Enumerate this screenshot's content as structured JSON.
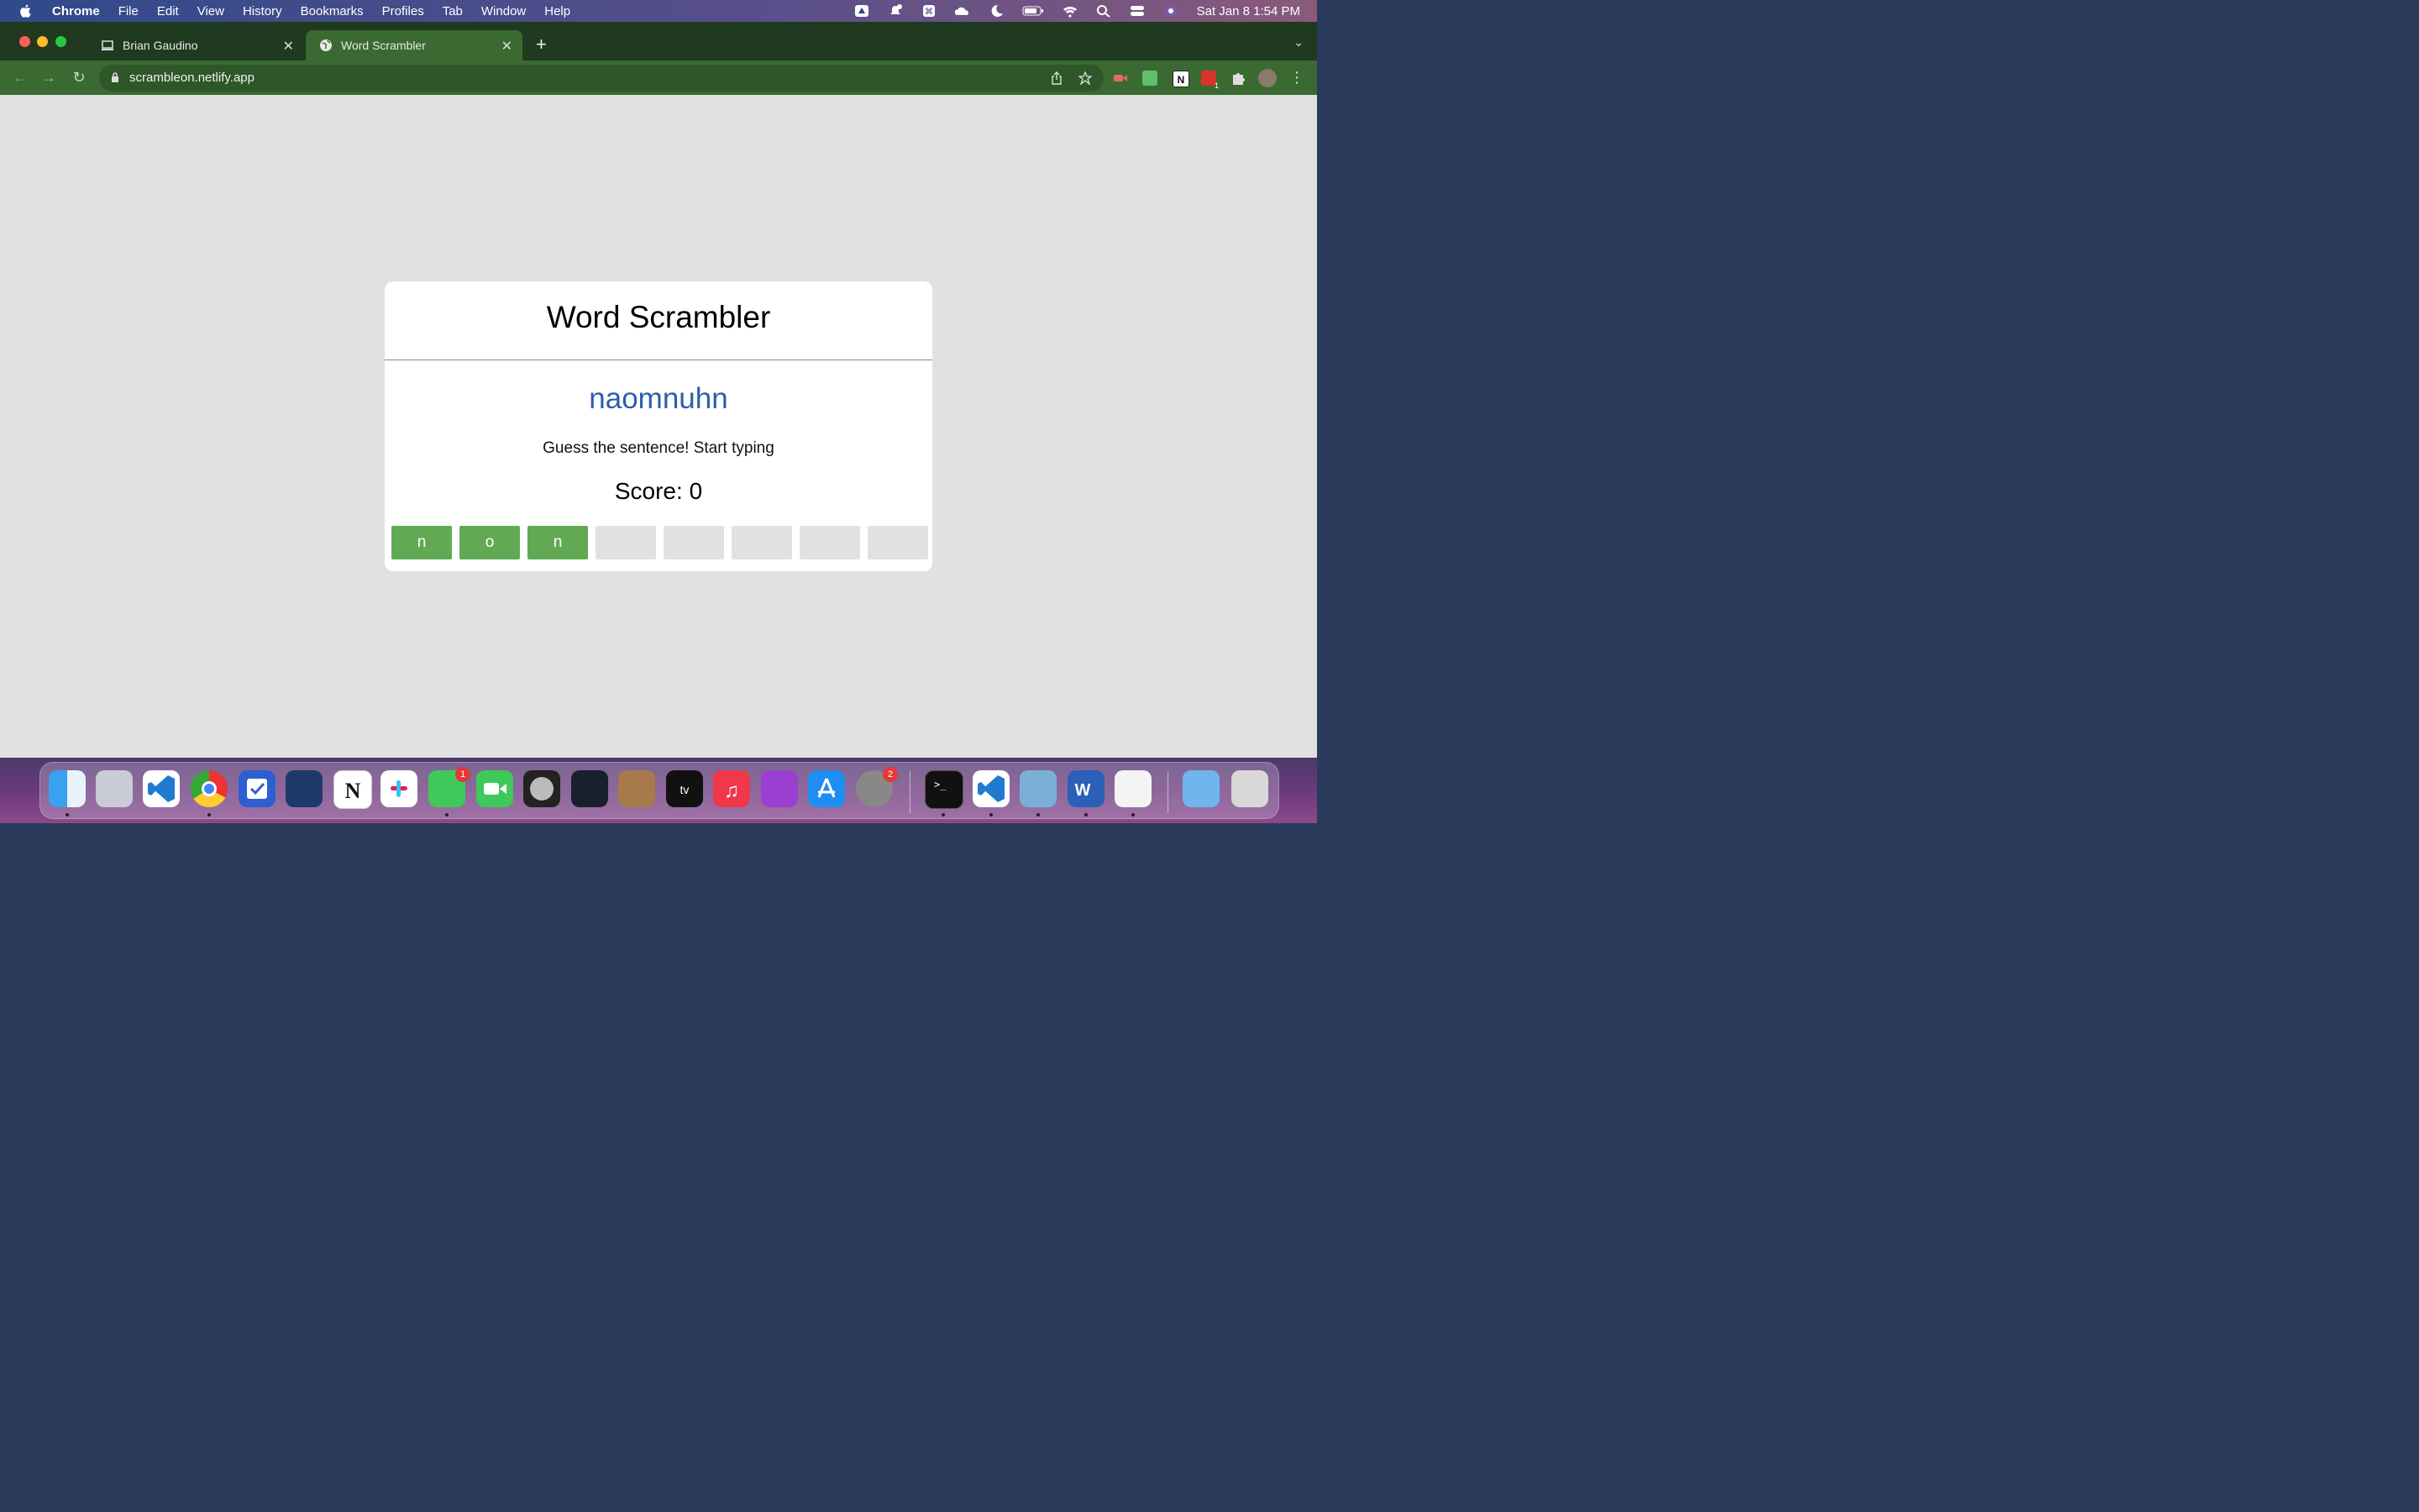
{
  "menubar": {
    "items": [
      "Chrome",
      "File",
      "Edit",
      "View",
      "History",
      "Bookmarks",
      "Profiles",
      "Tab",
      "Window",
      "Help"
    ],
    "clock": "Sat Jan 8  1:54 PM"
  },
  "browser": {
    "tabs": [
      {
        "title": "Brian Gaudino",
        "active": false
      },
      {
        "title": "Word Scrambler",
        "active": true
      }
    ],
    "url": "scrambleon.netlify.app",
    "extension_badge": "1"
  },
  "app": {
    "title": "Word Scrambler",
    "scrambled_word": "naomnuhn",
    "instructions": "Guess the sentence! Start typing",
    "score_text": "Score: 0",
    "tiles": [
      "n",
      "o",
      "n",
      "",
      "",
      "",
      "",
      ""
    ],
    "correct_color": "#61aa53",
    "empty_color": "#e1e1e1",
    "scramble_color": "#2b5fab"
  },
  "dock": {
    "messages_badge": "1",
    "settings_badge": "2"
  }
}
